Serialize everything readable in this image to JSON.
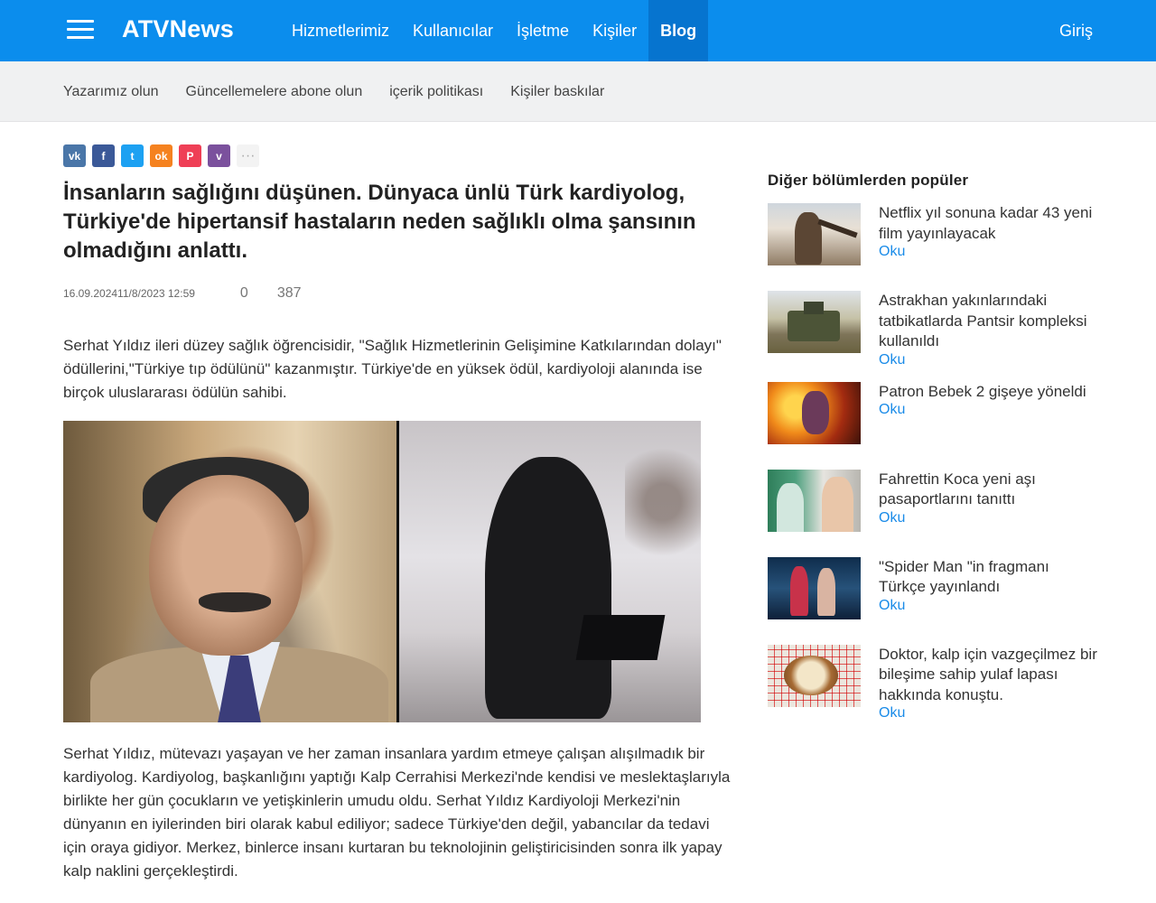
{
  "header": {
    "logo": "ATVNews",
    "nav": [
      "Hizmetlerimiz",
      "Kullanıcılar",
      "İşletme",
      "Kişiler",
      "Blog"
    ],
    "active_nav": "Blog",
    "login": "Giriş"
  },
  "subnav": [
    "Yazarımız olun",
    "Güncellemelere abone olun",
    "içerik politikası",
    "Kişiler baskılar"
  ],
  "share": {
    "buttons": [
      {
        "icon": "vk-icon",
        "glyph": "vk",
        "color": "#4a76a8"
      },
      {
        "icon": "facebook-icon",
        "glyph": "f",
        "color": "#3b5998"
      },
      {
        "icon": "twitter-icon",
        "glyph": "t",
        "color": "#1da1f2"
      },
      {
        "icon": "odnoklassniki-icon",
        "glyph": "ok",
        "color": "#f58220"
      },
      {
        "icon": "pocket-icon",
        "glyph": "P",
        "color": "#ef3f56"
      },
      {
        "icon": "viber-icon",
        "glyph": "v",
        "color": "#7b519d"
      }
    ],
    "more": "···"
  },
  "article": {
    "title": "İnsanların sağlığını düşünen. Dünyaca ünlü Türk kardiyolog, Türkiye'de hipertansif hastaların neden sağlıklı olma şansının olmadığını anlattı.",
    "date": "16.09.202411/8/2023 12:59",
    "comments": "0",
    "views": "387",
    "paragraph1": "Serhat Yıldız ileri düzey sağlık öğrencisidir, \"Sağlık Hizmetlerinin Gelişimine Katkılarından dolayı\" ödüllerini,\"Türkiye tıp ödülünü\" kazanmıştır. Türkiye'de en yüksek ödül, kardiyoloji alanında ise birçok uluslararası ödülün sahibi.",
    "paragraph2": "Serhat Yıldız, mütevazı yaşayan ve her zaman insanlara yardım etmeye çalışan alışılmadık bir kardiyolog. Kardiyolog, başkanlığını yaptığı Kalp Cerrahisi Merkezi'nde kendisi ve meslektaşlarıyla birlikte her gün çocukların ve yetişkinlerin umudu oldu. Serhat Yıldız Kardiyoloji Merkezi'nin dünyanın en iyilerinden biri olarak kabul ediliyor; sadece Türkiye'den değil, yabancılar da tedavi için oraya gidiyor. Merkez, binlerce insanı kurtaran bu teknolojinin geliştiricisinden sonra ilk yapay kalp naklini gerçekleştirdi."
  },
  "sidebar": {
    "title": "Diğer bölümlerden popüler",
    "link_label": "Oku",
    "items": [
      {
        "text": "Netflix yıl sonuna kadar 43 yeni film yayınlayacak",
        "link": "Oku"
      },
      {
        "text": "Astrakhan yakınlarındaki tatbikatlarda Pantsir kompleksi kullanıldı",
        "link": "Oku"
      },
      {
        "text": "Patron Bebek 2 gişeye yöneldi",
        "link": "Oku"
      },
      {
        "text": "Fahrettin Koca yeni aşı pasaportlarını tanıttı",
        "link": "Oku"
      },
      {
        "text": "\"Spider Man \"in fragmanı Türkçe yayınlandı",
        "link": "Oku"
      },
      {
        "text": "Doktor, kalp için vazgeçilmez bir bileşime sahip yulaf lapası hakkında konuştu.",
        "link": "Oku"
      }
    ]
  }
}
